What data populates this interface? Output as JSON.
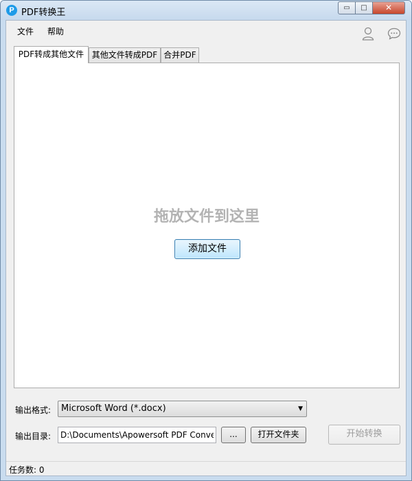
{
  "window": {
    "title": "PDF转换王",
    "icon_letter": "P",
    "controls": {
      "minimize": "▭",
      "maximize": "□",
      "close": "✕"
    }
  },
  "menu": {
    "file": "文件",
    "help": "帮助"
  },
  "header_icons": [
    "user-icon",
    "chat-icon"
  ],
  "tabs": [
    {
      "label": "PDF转成其他文件",
      "active": true
    },
    {
      "label": "其他文件转成PDF",
      "active": false
    },
    {
      "label": "合并PDF",
      "active": false
    }
  ],
  "drop_area": {
    "hint": "拖放文件到这里",
    "add_button": "添加文件"
  },
  "output": {
    "format_label": "输出格式:",
    "format_value": "Microsoft Word (*.docx)",
    "dir_label": "输出目录:",
    "dir_value": "D:\\Documents\\Apowersoft PDF Conver",
    "browse_label": "...",
    "open_folder_label": "打开文件夹",
    "start_label": "开始转换"
  },
  "status": {
    "task_count": "任务数: 0"
  }
}
